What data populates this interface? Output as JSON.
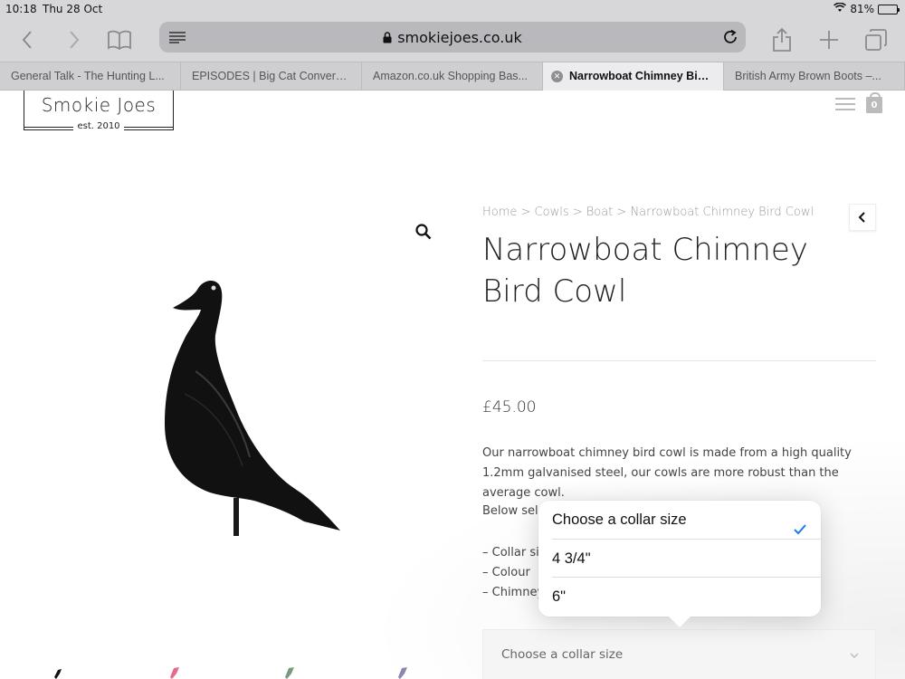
{
  "status": {
    "time": "10:18",
    "date": "Thu 28 Oct",
    "battery": "81%",
    "battery_level": 0.81
  },
  "browser": {
    "url": "smokiejoes.co.uk",
    "tabs": [
      {
        "label": "General Talk - The Hunting L..."
      },
      {
        "label": "EPISODES | Big Cat Convers..."
      },
      {
        "label": "Amazon.co.uk Shopping Bas..."
      },
      {
        "label": "Narrowboat Chimney Bird...",
        "active": true
      },
      {
        "label": "British Army Brown Boots –..."
      }
    ]
  },
  "site": {
    "logo_name": "Smokie Joes",
    "logo_est": "est. 2010",
    "cart_count": "0"
  },
  "product": {
    "breadcrumb": "Home > Cowls > Boat > Narrowboat Chimney Bird Cowl",
    "title": "Narrowboat Chimney Bird Cowl",
    "price": "£45.00",
    "description": "Our narrowboat chimney bird cowl is made from a high quality 1.2mm galvanised steel, our cowls are more robust than the average cowl.",
    "below_text": "Below sele",
    "bullets": [
      "– Collar siz",
      "– Colour",
      "– Chimney"
    ],
    "select_value": "Choose a collar size"
  },
  "popover": {
    "options": [
      {
        "label": "Choose a collar size",
        "selected": true
      },
      {
        "label": "4 3/4\""
      },
      {
        "label": "6\""
      }
    ]
  },
  "colors": {
    "accent": "#1a7cf2",
    "chrome": "#d7d7d9"
  }
}
